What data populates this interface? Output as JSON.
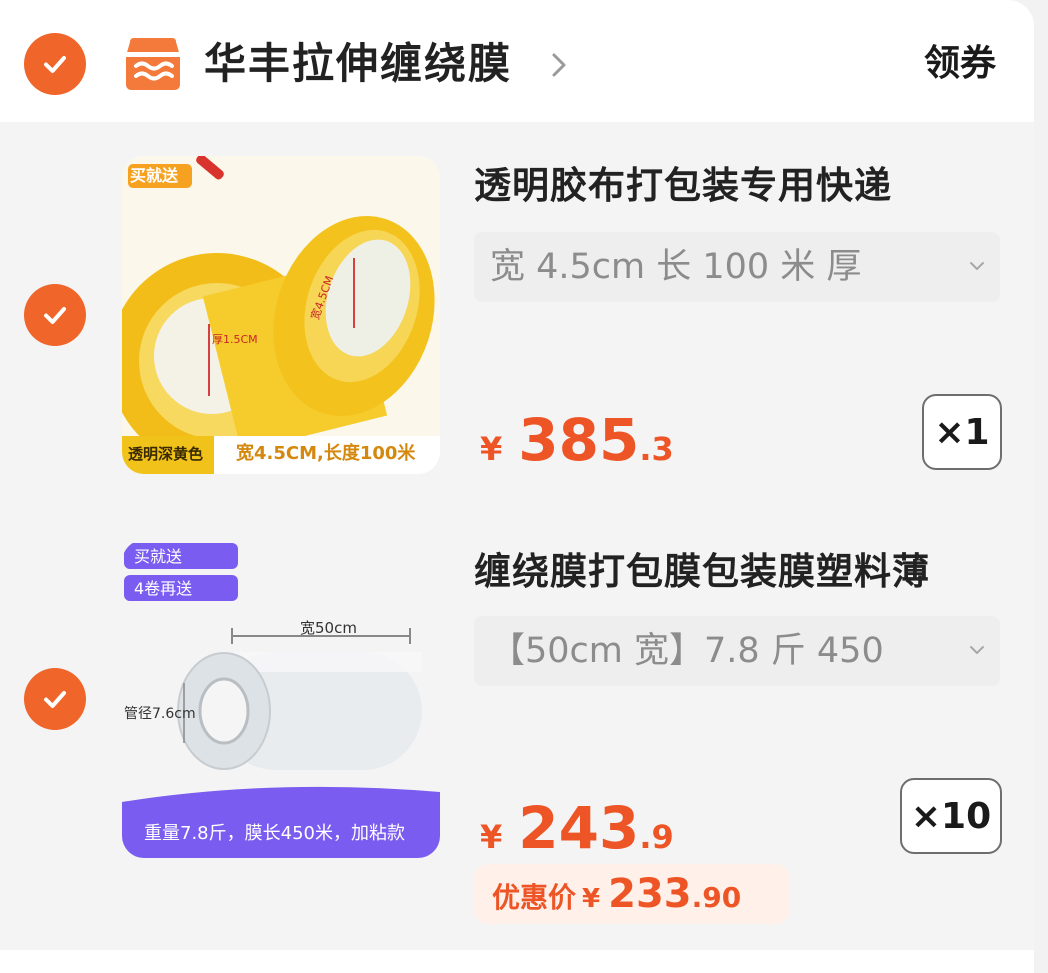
{
  "shop": {
    "name": "华丰拉伸缠绕膜",
    "coupon_label": "领券",
    "icon": "shop-storefront-icon",
    "checked": true
  },
  "colors": {
    "accent": "#f0652a",
    "price": "#ee5526",
    "discount_bg": "#fff0ea",
    "tape": "#f5c518",
    "promo_purple": "#7b5cf0"
  },
  "items": [
    {
      "checked": true,
      "title": "透明胶布打包装专用快递",
      "spec": "宽 4.5cm 长 100 米 厚",
      "price_symbol": "¥",
      "price_int": "385",
      "price_dec": ".3",
      "quantity": "×1",
      "image": {
        "badge": "买就送",
        "side_label": "厚1.5CM",
        "roll_label": "宽4.5CM",
        "bottom_left": "透明深黄色",
        "bottom_right": "宽4.5CM,长度100米"
      }
    },
    {
      "checked": true,
      "title": "缠绕膜打包膜包装膜塑料薄",
      "spec": "【50cm 宽】7.8 斤 450",
      "price_symbol": "¥",
      "price_int": "243",
      "price_dec": ".9",
      "quantity": "×10",
      "discount_label": "优惠价",
      "discount_symbol": "¥",
      "discount_int": "233",
      "discount_dec": ".90",
      "image": {
        "badge_1": "买就送",
        "badge_2": "4卷再送",
        "width_label": "宽50cm",
        "core_label": "管径7.6cm",
        "banner": "重量7.8斤，膜长450米，加粘款"
      }
    }
  ]
}
